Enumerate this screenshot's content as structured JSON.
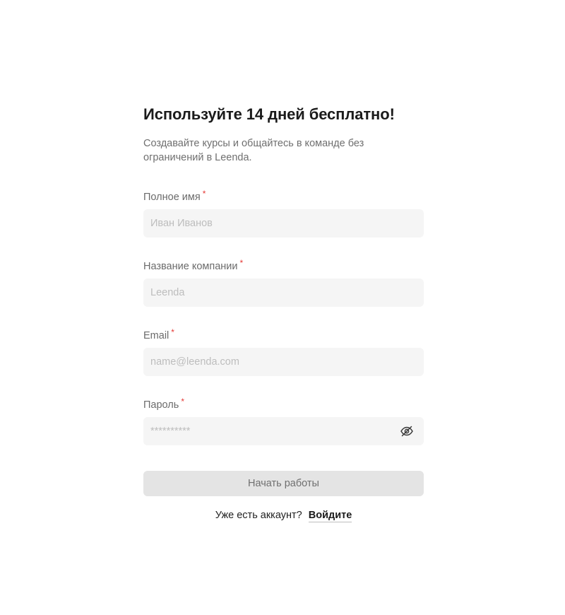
{
  "heading": "Используйте 14 дней бесплатно!",
  "subtitle": "Создавайте курсы и общайтесь в команде без ограничений в Leenda.",
  "required_marker": "*",
  "fields": {
    "full_name": {
      "label": "Полное имя",
      "placeholder": "Иван Иванов",
      "value": ""
    },
    "company": {
      "label": "Название компании",
      "placeholder": "Leenda",
      "value": ""
    },
    "email": {
      "label": "Email",
      "placeholder": "name@leenda.com",
      "value": ""
    },
    "password": {
      "label": "Пароль",
      "placeholder": "**********",
      "value": "",
      "toggle_icon": "eye-off-icon"
    }
  },
  "submit_label": "Начать работы",
  "login": {
    "prompt": "Уже есть аккаунт?",
    "link_label": "Войдите"
  },
  "colors": {
    "input_background": "#f5f5f5",
    "button_background": "#e4e4e4",
    "required": "#e53935"
  }
}
